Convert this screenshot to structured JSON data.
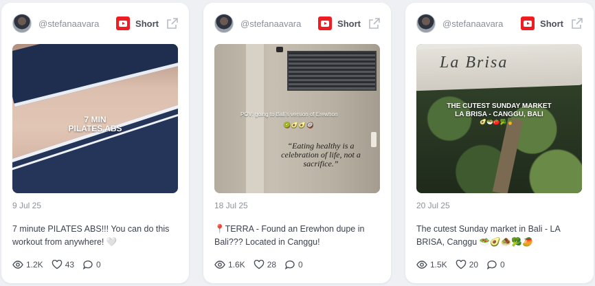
{
  "posts": [
    {
      "handle": "@stefanaavara",
      "platform_label": "Short",
      "date": "9 Jul 25",
      "caption": "7 minute PILATES ABS!!! You can do this workout from anywhere! 🤍",
      "thumb_overlay": "7 MIN\nPILATES ABS",
      "views": "1.2K",
      "likes": "43",
      "comments": "0"
    },
    {
      "handle": "@stefanaavara",
      "platform_label": "Short",
      "date": "18 Jul 25",
      "caption": "📍TERRA - Found an Erewhon dupe in Bali??? Located in Canggu!",
      "thumb_overlay_top": "POV: going to Bali’s version of Erewhon",
      "thumb_emojis": "🥝🥑🥑🥥",
      "thumb_quote": "“Eating healthy is a celebration of life, not a sacrifice.”",
      "views": "1.6K",
      "likes": "28",
      "comments": "0"
    },
    {
      "handle": "@stefanaavara",
      "platform_label": "Short",
      "date": "20 Jul 25",
      "caption": "The cutest Sunday market in Bali - LA BRISA, Canggu 🥗🥑🧆🥦🥭",
      "thumb_sign": "La Brisa",
      "thumb_overlay": "THE CUTEST SUNDAY MARKET\nLA BRISA - CANGGU, BALI",
      "thumb_emojis": "🥑🥗🍅🥦🍍",
      "views": "1.5K",
      "likes": "20",
      "comments": "0"
    }
  ],
  "colors": {
    "youtube_red": "#ef1d22",
    "card_bg": "#ffffff",
    "page_bg": "#eef0f4"
  },
  "icons": {
    "platform": "youtube-icon",
    "external": "external-link-icon",
    "views": "eye-icon",
    "likes": "heart-icon",
    "comments": "comment-icon"
  }
}
